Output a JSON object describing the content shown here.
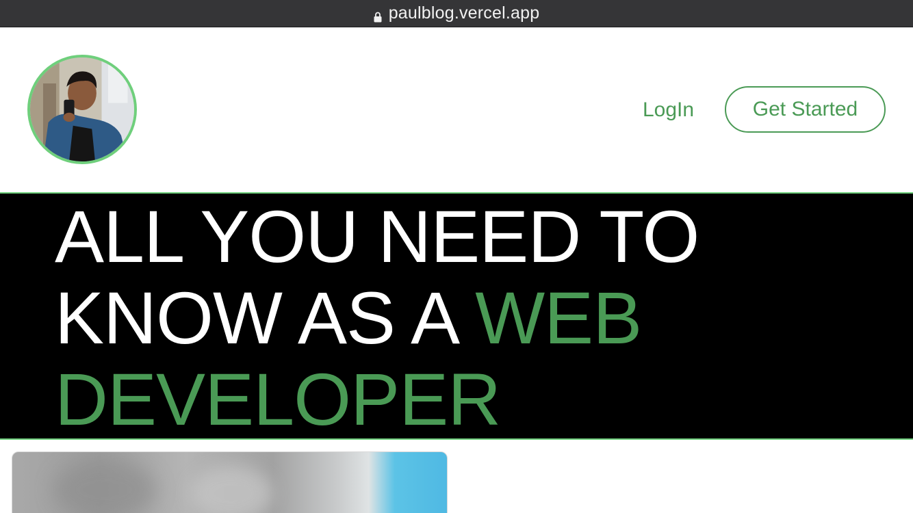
{
  "browser": {
    "url": "paulblog.vercel.app"
  },
  "header": {
    "login_label": "LogIn",
    "get_started_label": "Get Started"
  },
  "hero": {
    "line1": "ALL YOU NEED TO",
    "line2_plain": "KNOW AS A ",
    "line2_accent": "WEB",
    "line3_accent": "DEVELOPER"
  },
  "colors": {
    "accent_green": "#4a9a55",
    "border_green": "#6fcf7c",
    "hero_background": "#000000",
    "url_bar": "#353537"
  },
  "icons": [
    "lock-icon",
    "avatar-photo"
  ]
}
